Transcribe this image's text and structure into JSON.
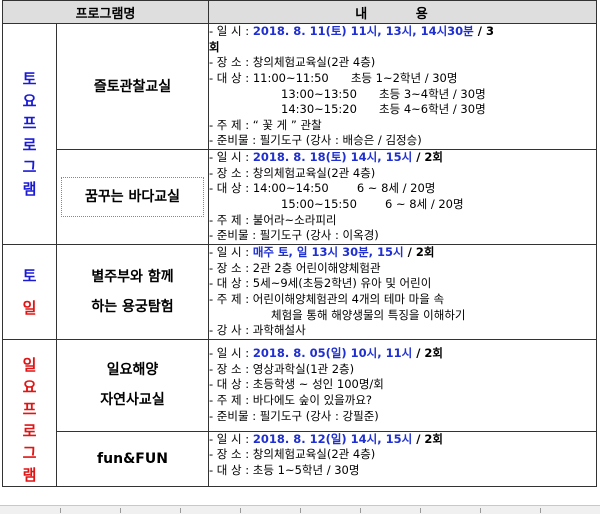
{
  "header": {
    "col_program": "프로그램명",
    "col_content": "내 용"
  },
  "categories": {
    "saturday_program": [
      "토",
      "요",
      "프",
      "로",
      "그",
      "램"
    ],
    "saturday": [
      "토",
      "일"
    ],
    "sunday_program": [
      "일",
      "요",
      "프",
      "로",
      "그",
      "램"
    ]
  },
  "programs": [
    {
      "name": "즐토관찰교실",
      "lines": [
        {
          "pre": "- 일 시 : ",
          "hl": "2018. 8. 11(토) 11시, 13시, 14시30분",
          "post": " / 3"
        },
        {
          "cont": "회"
        },
        {
          "pre": "- 장 소 : 창의체험교육실(2관 4층)"
        },
        {
          "pre": "- 대 상 : ",
          "a": "11:00~11:50",
          "b": "초등 1~2학년 / 30명"
        },
        {
          "indent": true,
          "a": "13:00~13:50",
          "b": "초등 3~4학년 / 30명"
        },
        {
          "indent": true,
          "a": "14:30~15:20",
          "b": "초등 4~6학년 / 30명"
        },
        {
          "pre": "- 주 제 : “ 꽃 게 ” 관찰"
        },
        {
          "pre": "- 준비물 : 필기도구 (강사 : 배승은 / 김정승)"
        }
      ]
    },
    {
      "name": "꿈꾸는 바다교실",
      "lines": [
        {
          "pre": "- 일 시 : ",
          "hl": "2018. 8. 18(토) 14시, 15시",
          "post": " / 2회"
        },
        {
          "pre": "- 장 소 : 창의체험교육실(2관 4층)"
        },
        {
          "pre": "- 대 상 : ",
          "a": "14:00~14:50",
          "b": "6 ~ 8세 / 20명"
        },
        {
          "indent": true,
          "a": "15:00~15:50",
          "b": "6 ~ 8세 / 20명"
        },
        {
          "pre": "- 주 제 : 불어라~소라피리"
        },
        {
          "pre": "- 준비물 : 필기도구 (강사 : 이옥경)"
        }
      ]
    },
    {
      "name_lines": [
        "별주부와 함께",
        "하는 용궁탐험"
      ],
      "lines": [
        {
          "pre": "- 일 시 : ",
          "hl": "매주 토, 일 13시 30분, 15시",
          "post": " / 2회"
        },
        {
          "pre": "- 장 소 : 2관 2층 어린이해양체험관"
        },
        {
          "pre": "- 대 상 : 5세~9세(초등2학년) 유아 및 어린이"
        },
        {
          "pre": "- 주 제 : 어린이해양체험관의 4개의 테마 마을 속"
        },
        {
          "indent2": "체험을 통해 해양생물의 특징을 이해하기"
        },
        {
          "pre": "- 강 사 : 과학해설사"
        }
      ]
    },
    {
      "name_lines": [
        "일요해양",
        "자연사교실"
      ],
      "lines": [
        {
          "pre": "- 일 시 : ",
          "hl": "2018. 8. 05(일) 10시, 11시",
          "post": " / 2회"
        },
        {
          "pre": "- 장 소 : 영상과학실(1관 2층)"
        },
        {
          "pre": "- 대 상 : 초등학생 ~ 성인 100명/회"
        },
        {
          "pre": "- 주 제 : 바다에도 숲이 있을까요?"
        },
        {
          "pre": "- 준비물 : 필기도구 (강사 : 강필준)"
        }
      ]
    },
    {
      "name": "fun&FUN",
      "lines": [
        {
          "pre": "- 일 시 : ",
          "hl": "2018. 8. 12(일) 14시, 15시",
          "post": " / 2회"
        },
        {
          "pre": "- 장 소 : 창의체험교육실(2관 4층)"
        },
        {
          "pre": "- 대 상 : 초등 1~5학년 / 30명"
        }
      ]
    }
  ]
}
